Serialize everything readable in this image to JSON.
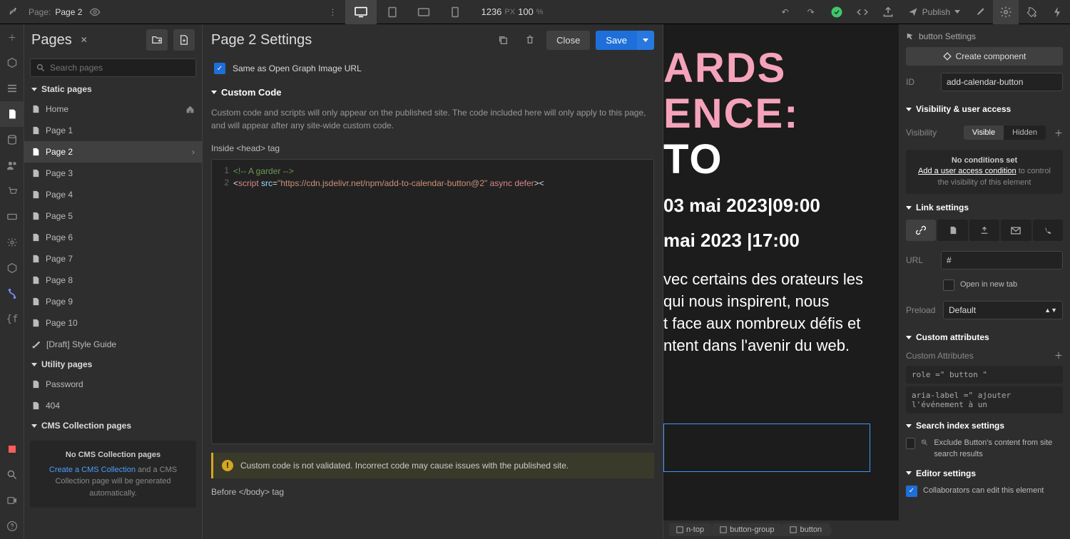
{
  "topbar": {
    "page_label": "Page:",
    "page_name": "Page 2",
    "canvas_width": "1236",
    "px": "PX",
    "zoom": "100",
    "pct": "%",
    "publish": "Publish"
  },
  "pages_panel": {
    "title": "Pages",
    "search_placeholder": "Search pages",
    "static_header": "Static pages",
    "pages": [
      "Home",
      "Page 1",
      "Page 2",
      "Page 3",
      "Page 4",
      "Page 5",
      "Page 6",
      "Page 7",
      "Page 8",
      "Page 9",
      "Page 10",
      "[Draft] Style Guide"
    ],
    "utility_header": "Utility pages",
    "utility": [
      "Password",
      "404"
    ],
    "cms_header": "CMS Collection pages",
    "no_cms_title": "No CMS Collection pages",
    "no_cms_link": "Create a CMS Collection",
    "no_cms_rest": " and a CMS Collection page will be generated automatically."
  },
  "settings": {
    "title": "Page 2 Settings",
    "close": "Close",
    "save": "Save",
    "og_same": "Same as Open Graph Image URL",
    "cc_header": "Custom Code",
    "cc_desc": "Custom code and scripts will only appear on the published site. The code included here will only apply to this page, and will appear after any site-wide custom code.",
    "head_label": "Inside <head> tag",
    "code_line1": "<!-- A garder -->",
    "code_script_src": "https://cdn.jsdelivr.net/npm/add-to-calendar-button@2",
    "warning": "Custom code is not validated. Incorrect code may cause issues with the published site.",
    "body_label": "Before </body> tag"
  },
  "canvas": {
    "h1": "ARDS",
    "h2": "ENCE:",
    "h3": "TO",
    "d1": "03 mai 2023|09:00",
    "d2": "mai 2023 |17:00",
    "b1": "vec certains des orateurs les",
    "b2": "qui nous inspirent, nous",
    "b3": "t face aux nombreux défis et",
    "b4": "ntent dans l'avenir du web."
  },
  "breadcrumbs": [
    "n-top",
    "button-group",
    "button"
  ],
  "right": {
    "elem_label": "button Settings",
    "create_component": "Create component",
    "id_label": "ID",
    "id_value": "add-calendar-button",
    "vis_header": "Visibility & user access",
    "vis_label": "Visibility",
    "visible": "Visible",
    "hidden": "Hidden",
    "cond_title": "No conditions set",
    "cond_link": "Add a user access condition",
    "cond_rest": " to control the visibility of this element",
    "link_header": "Link settings",
    "url_label": "URL",
    "url_value": "#",
    "new_tab": "Open in new tab",
    "preload_label": "Preload",
    "preload_value": "Default",
    "custom_attr_header": "Custom attributes",
    "custom_attr_label": "Custom Attributes",
    "attr1": "role =\" button \"",
    "attr2": "aria-label =\" ajouter l'événement à un",
    "search_header": "Search index settings",
    "search_exclude": "Exclude Button's content from site search results",
    "editor_header": "Editor settings",
    "editor_collab": "Collaborators can edit this element"
  }
}
